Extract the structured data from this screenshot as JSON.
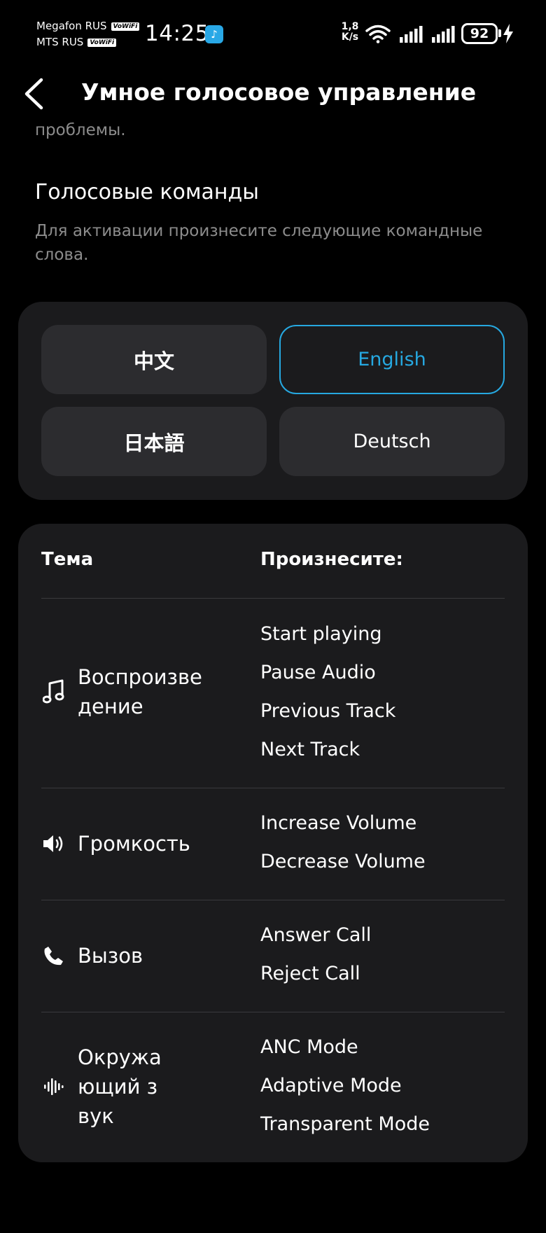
{
  "status_bar": {
    "carrier1": "Megafon RUS",
    "carrier2": "MTS RUS",
    "vowifi_badge": "VoWiFi",
    "time": "14:25",
    "app_badge_icon": "music-note-app-icon",
    "net_speed_value": "1,8",
    "net_speed_unit": "K/s",
    "battery_level": "92"
  },
  "header": {
    "title": "Умное голосовое управление"
  },
  "intro": {
    "clipped_text": "проблемы."
  },
  "voice_commands": {
    "title": "Голосовые команды",
    "description": "Для активации произнесите следующие командные слова."
  },
  "languages": [
    {
      "label": "中文",
      "selected": false
    },
    {
      "label": "English",
      "selected": true
    },
    {
      "label": "日本語",
      "selected": false
    },
    {
      "label": "Deutsch",
      "selected": false
    }
  ],
  "commands_table": {
    "header_topic": "Тема",
    "header_say": "Произнесите:",
    "rows": [
      {
        "icon": "music-note-icon",
        "topic": "Воспроизведение",
        "commands": [
          "Start playing",
          "Pause Audio",
          "Previous Track",
          "Next Track"
        ]
      },
      {
        "icon": "speaker-icon",
        "topic": "Громкость",
        "commands": [
          "Increase Volume",
          "Decrease Volume"
        ]
      },
      {
        "icon": "phone-icon",
        "topic": "Вызов",
        "commands": [
          "Answer Call",
          "Reject Call"
        ]
      },
      {
        "icon": "sound-wave-icon",
        "topic": "Окружающий звук",
        "commands": [
          "ANC Mode",
          "Adaptive Mode",
          "Transparent Mode"
        ]
      }
    ]
  },
  "colors": {
    "accent": "#26a8e0",
    "card_bg": "#1b1b1d",
    "button_bg": "#2c2c2f",
    "secondary_text": "#8c8c8c"
  }
}
